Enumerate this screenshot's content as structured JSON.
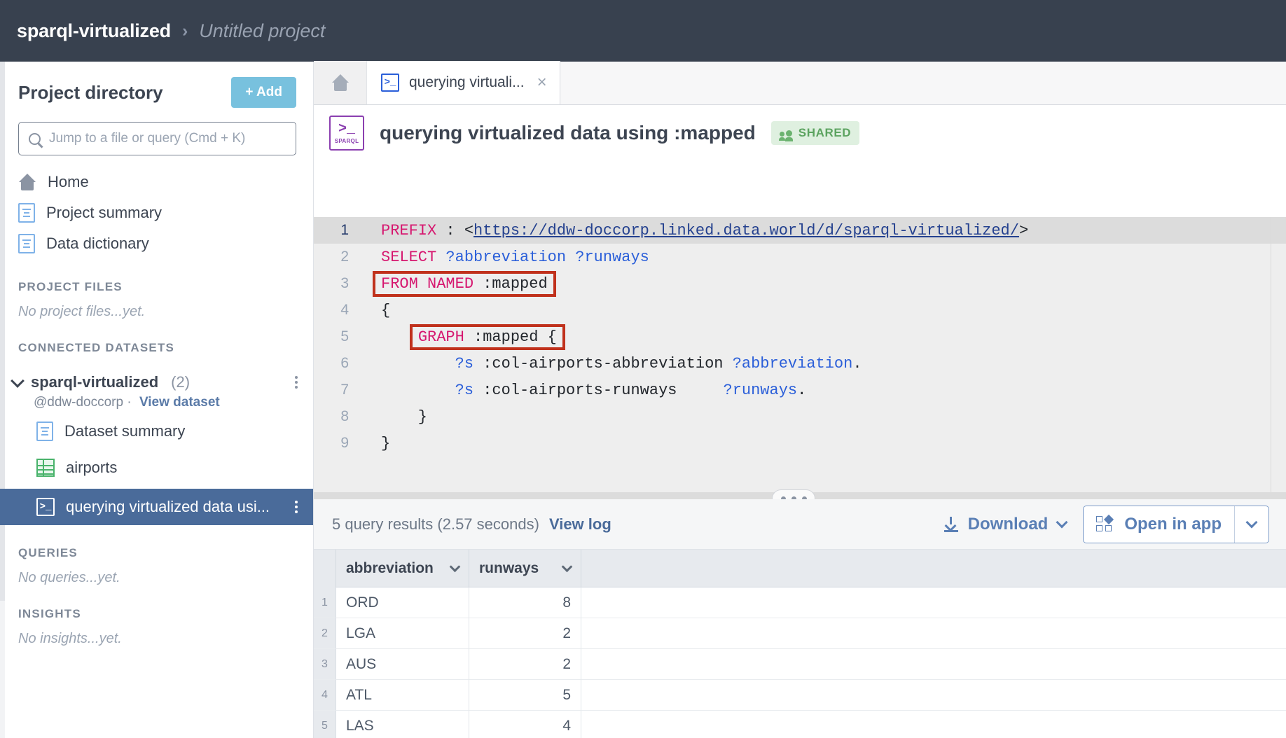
{
  "topbar": {
    "breadcrumb_root": "sparql-virtualized",
    "breadcrumb_separator": "›",
    "breadcrumb_current": "Untitled project"
  },
  "sidebar": {
    "title": "Project directory",
    "add_label": "+ Add",
    "search_placeholder": "Jump to a file or query (Cmd + K)",
    "search_value": "",
    "nav": [
      {
        "label": "Home",
        "icon": "home-icon"
      },
      {
        "label": "Project summary",
        "icon": "document-icon"
      },
      {
        "label": "Data dictionary",
        "icon": "document-icon"
      }
    ],
    "sections": [
      {
        "heading": "PROJECT FILES",
        "empty": "No project files...yet."
      },
      {
        "heading": "CONNECTED DATASETS",
        "empty": ""
      },
      {
        "heading": "QUERIES",
        "empty": "No queries...yet."
      },
      {
        "heading": "INSIGHTS",
        "empty": "No insights...yet."
      }
    ],
    "dataset": {
      "name": "sparql-virtualized",
      "count": "(2)",
      "owner": "@ddw-doccorp ·",
      "view_link": "View dataset",
      "children": [
        {
          "label": "Dataset summary",
          "icon": "document-icon",
          "selected": false
        },
        {
          "label": "airports",
          "icon": "table-icon",
          "selected": false
        },
        {
          "label": "querying virtualized data usi...",
          "icon": "sparql-icon",
          "selected": true
        }
      ]
    }
  },
  "tabs": {
    "home_tab_icon": "home-icon",
    "items": [
      {
        "label": "querying virtuali...",
        "icon": "sparql-icon",
        "close": "×",
        "active": true
      }
    ]
  },
  "query_header": {
    "icon_glyph": ">_",
    "icon_name": "SPARQL",
    "title": "querying virtualized data using :mapped",
    "badge": "SHARED"
  },
  "editor": {
    "lines": [
      {
        "n": "1",
        "active": true,
        "tokens": [
          {
            "t": "PREFIX ",
            "c": "kw"
          },
          {
            "t": ": ",
            "c": "plain"
          },
          {
            "t": "<",
            "c": "plain"
          },
          {
            "t": "https://ddw-doccorp.linked.data.world/d/sparql-virtualized/",
            "c": "uri"
          },
          {
            "t": ">",
            "c": "plain"
          }
        ]
      },
      {
        "n": "2",
        "active": false,
        "tokens": [
          {
            "t": "SELECT ",
            "c": "kw"
          },
          {
            "t": "?abbreviation ?runways",
            "c": "var"
          }
        ]
      },
      {
        "n": "3",
        "active": false,
        "box": true,
        "tokens": [
          {
            "t": "FROM NAMED ",
            "c": "kw"
          },
          {
            "t": ":mapped",
            "c": "plain"
          }
        ]
      },
      {
        "n": "4",
        "active": false,
        "tokens": [
          {
            "t": "{",
            "c": "plain"
          }
        ]
      },
      {
        "n": "5",
        "active": false,
        "boxIndent": true,
        "tokens": [
          {
            "t": "    ",
            "c": "plain"
          },
          {
            "t": "GRAPH ",
            "c": "kw"
          },
          {
            "t": ":mapped",
            "c": "plain"
          },
          {
            "t": " {",
            "c": "plain"
          }
        ]
      },
      {
        "n": "6",
        "active": false,
        "tokens": [
          {
            "t": "        ?s",
            "c": "var"
          },
          {
            "t": " :col-airports-abbreviation ",
            "c": "plain"
          },
          {
            "t": "?abbreviation",
            "c": "var"
          },
          {
            "t": ".",
            "c": "plain"
          }
        ]
      },
      {
        "n": "7",
        "active": false,
        "tokens": [
          {
            "t": "        ?s",
            "c": "var"
          },
          {
            "t": " :col-airports-runways     ",
            "c": "plain"
          },
          {
            "t": "?runways",
            "c": "var"
          },
          {
            "t": ".",
            "c": "plain"
          }
        ]
      },
      {
        "n": "8",
        "active": false,
        "tokens": [
          {
            "t": "    }",
            "c": "plain"
          }
        ]
      },
      {
        "n": "9",
        "active": false,
        "tokens": [
          {
            "t": "}",
            "c": "plain"
          }
        ]
      }
    ],
    "highlight_color": "#c0311c"
  },
  "results": {
    "meta": "5 query results (2.57 seconds)",
    "view_log": "View log",
    "download_label": "Download",
    "open_in_app_label": "Open in app",
    "columns": [
      "abbreviation",
      "runways"
    ],
    "rows": [
      {
        "index": "1",
        "abbreviation": "ORD",
        "runways": "8"
      },
      {
        "index": "2",
        "abbreviation": "LGA",
        "runways": "2"
      },
      {
        "index": "3",
        "abbreviation": "AUS",
        "runways": "2"
      },
      {
        "index": "4",
        "abbreviation": "ATL",
        "runways": "5"
      },
      {
        "index": "5",
        "abbreviation": "LAS",
        "runways": "4"
      }
    ]
  },
  "colors": {
    "topbar_bg": "#38414f",
    "accent_blue": "#78c1de",
    "selected_row": "#4a6b9a",
    "keyword": "#d6176f",
    "variable": "#2b5fd9",
    "uri": "#24418f",
    "shared_badge_bg": "#dff0e0",
    "shared_badge_fg": "#5ba35f"
  }
}
